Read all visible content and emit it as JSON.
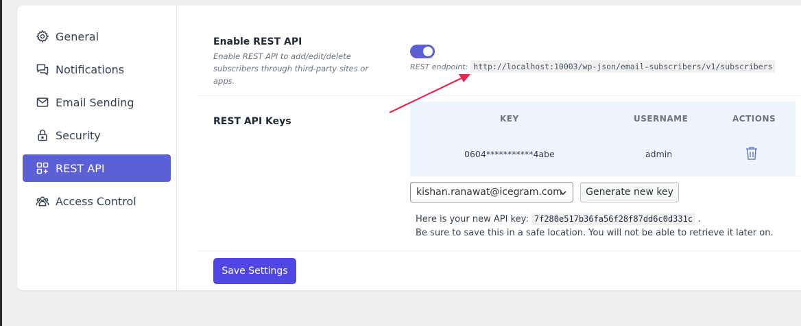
{
  "sidebar": {
    "items": [
      {
        "label": "General",
        "icon": "gear-icon"
      },
      {
        "label": "Notifications",
        "icon": "chat-icon"
      },
      {
        "label": "Email Sending",
        "icon": "mail-icon"
      },
      {
        "label": "Security",
        "icon": "lock-icon"
      },
      {
        "label": "REST API",
        "icon": "apps-add-icon",
        "active": true
      },
      {
        "label": "Access Control",
        "icon": "users-icon"
      }
    ]
  },
  "rest": {
    "title": "Enable REST API",
    "description": "Enable REST API to add/edit/delete subscribers through third-party sites or apps.",
    "enabled": true,
    "endpoint_label": "REST endpoint:",
    "endpoint_url": "http://localhost:10003/wp-json/email-subscribers/v1/subscribers"
  },
  "keys": {
    "title": "REST API Keys",
    "columns": [
      "KEY",
      "USERNAME",
      "ACTIONS"
    ],
    "rows": [
      {
        "key": "0604***********4abe",
        "username": "admin"
      }
    ],
    "selected_user": "kishan.ranawat@icegram.com",
    "generate_label": "Generate new key",
    "new_key_prefix": "Here is your new API key:",
    "new_key": "7f280e517b36fa56f28f87dd6c0d331c",
    "new_key_suffix": ".",
    "warning": "Be sure to save this in a safe location. You will not be able to retrieve it later on."
  },
  "save_label": "Save Settings",
  "colors": {
    "accent": "#5b60d6",
    "button": "#5046e5",
    "arrow": "#e8254f",
    "table_bg": "#eef5ff"
  }
}
